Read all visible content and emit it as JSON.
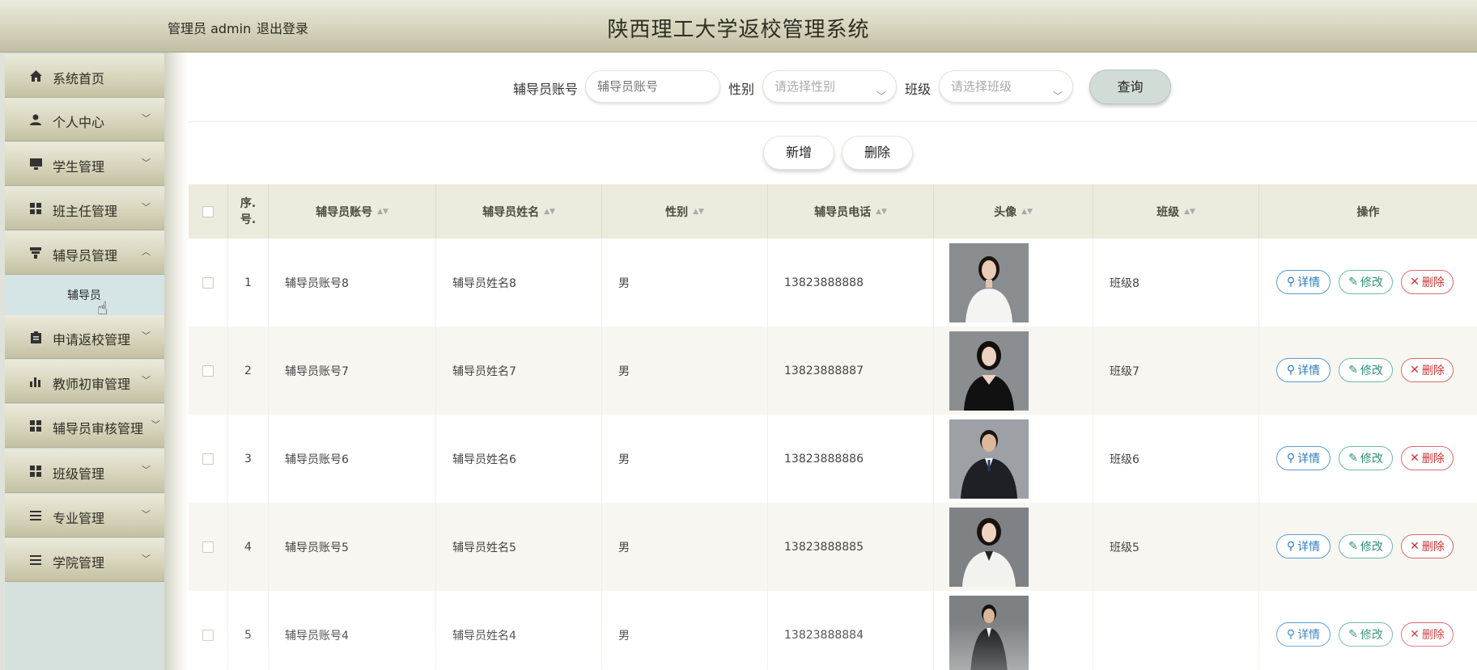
{
  "header": {
    "user_label": "管理员 admin",
    "logout_label": "退出登录",
    "title": "陕西理工大学返校管理系统"
  },
  "sidebar": {
    "items": [
      {
        "label": "系统首页",
        "icon": "home-icon",
        "has_children": false
      },
      {
        "label": "个人中心",
        "icon": "user-icon",
        "has_children": true
      },
      {
        "label": "学生管理",
        "icon": "monitor-icon",
        "has_children": true
      },
      {
        "label": "班主任管理",
        "icon": "grid-icon",
        "has_children": true
      },
      {
        "label": "辅导员管理",
        "icon": "flag-icon",
        "has_children": true,
        "expanded": true
      },
      {
        "label": "申请返校管理",
        "icon": "clipboard-icon",
        "has_children": true
      },
      {
        "label": "教师初审管理",
        "icon": "bar-chart-icon",
        "has_children": true
      },
      {
        "label": "辅导员审核管理",
        "icon": "grid-icon",
        "has_children": true
      },
      {
        "label": "班级管理",
        "icon": "grid-icon",
        "has_children": true
      },
      {
        "label": "专业管理",
        "icon": "list-icon",
        "has_children": true
      },
      {
        "label": "学院管理",
        "icon": "menu-icon",
        "has_children": true
      }
    ],
    "active_submenu": "辅导员"
  },
  "search": {
    "account_label": "辅导员账号",
    "account_placeholder": "辅导员账号",
    "gender_label": "性别",
    "gender_placeholder": "请选择性别",
    "class_label": "班级",
    "class_placeholder": "请选择班级",
    "query_button": "查询"
  },
  "actions": {
    "add_button": "新增",
    "delete_button": "删除"
  },
  "table": {
    "columns": {
      "index": "序.\n号.",
      "account": "辅导员账号",
      "name": "辅导员姓名",
      "gender": "性别",
      "phone": "辅导员电话",
      "avatar": "头像",
      "class": "班级",
      "ops": "操作"
    },
    "row_buttons": {
      "detail": "详情",
      "edit": "修改",
      "delete": "删除"
    },
    "rows": [
      {
        "index": "1",
        "account": "辅导员账号8",
        "name": "辅导员姓名8",
        "gender": "男",
        "phone": "13823888888",
        "class": "班级8",
        "avatar": "woman-white-shirt"
      },
      {
        "index": "2",
        "account": "辅导员账号7",
        "name": "辅导员姓名7",
        "gender": "男",
        "phone": "13823888887",
        "class": "班级7",
        "avatar": "woman-black-top"
      },
      {
        "index": "3",
        "account": "辅导员账号6",
        "name": "辅导员姓名6",
        "gender": "男",
        "phone": "13823888886",
        "class": "班级6",
        "avatar": "man-suit"
      },
      {
        "index": "4",
        "account": "辅导员账号5",
        "name": "辅导员姓名5",
        "gender": "男",
        "phone": "13823888885",
        "class": "班级5",
        "avatar": "woman-white-blazer"
      },
      {
        "index": "5",
        "account": "辅导员账号4",
        "name": "辅导员姓名4",
        "gender": "男",
        "phone": "13823888884",
        "class": "",
        "avatar": "man-dark-suit"
      }
    ]
  },
  "colors": {
    "header_bg": "#d6d3bd",
    "sidebar_bg": "#d5dfdb",
    "detail_blue": "#2f7cc0",
    "edit_teal": "#2b8f7a",
    "delete_red": "#c93434"
  }
}
